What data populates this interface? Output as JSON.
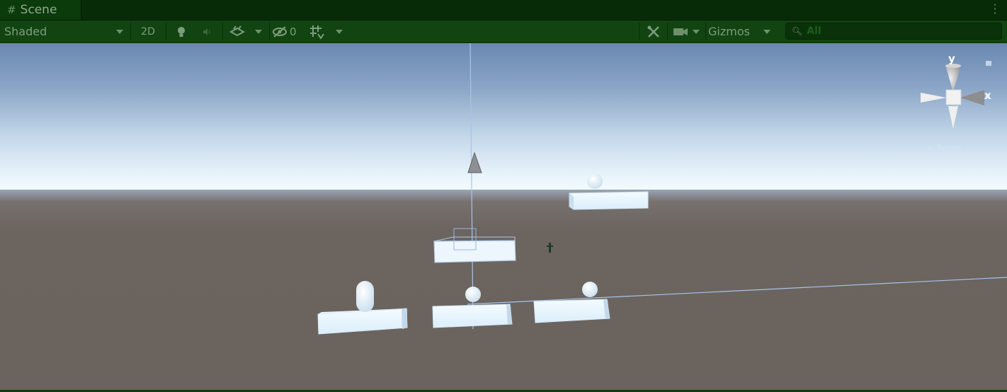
{
  "tab": {
    "label": "Scene",
    "icon": "grid-icon"
  },
  "toolbar": {
    "shading_mode": "Shaded",
    "mode_2d": "2D",
    "hidden_count": "0",
    "gizmos_label": "Gizmos",
    "search_placeholder": "All",
    "icons": [
      "lightbulb-icon",
      "audio-icon",
      "effects-icon",
      "visibility-icon",
      "grid-snap-icon",
      "tools-icon",
      "camera-icon"
    ]
  },
  "gizmo": {
    "axis_y": "y",
    "axis_x": "x",
    "projection": "< Persp"
  },
  "colors": {
    "chrome_dark": "#072a07",
    "toolbar": "#114411",
    "ground": "#6b645e",
    "sky_top": "#6f8db6",
    "horizon": "#e9f4fb"
  }
}
